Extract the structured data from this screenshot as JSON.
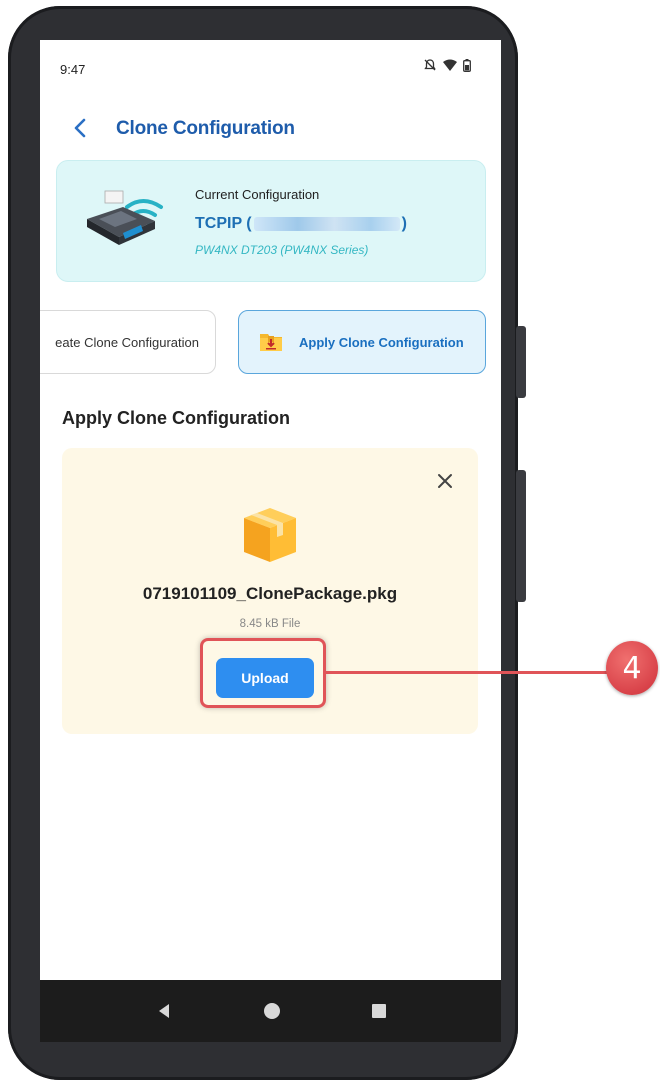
{
  "status_bar": {
    "time": "9:47"
  },
  "header": {
    "title": "Clone Configuration"
  },
  "current_config": {
    "label": "Current Configuration",
    "protocol_prefix": "TCPIP (",
    "protocol_suffix": ")",
    "model": "PW4NX DT203 (PW4NX Series)"
  },
  "tabs": [
    {
      "label": "eate Clone Configuration",
      "selected": false
    },
    {
      "label": "Apply Clone Configuration",
      "selected": true
    }
  ],
  "section": {
    "title": "Apply Clone Configuration",
    "file_name": "0719101109_ClonePackage.pkg",
    "file_size": "8.45 kB File",
    "upload_label": "Upload"
  },
  "callout": {
    "number": "4"
  },
  "colors": {
    "title_blue": "#1e5cab",
    "accent_blue": "#2e8ef0",
    "panel_bg": "#fef8e6",
    "highlight_red": "#e05458"
  }
}
